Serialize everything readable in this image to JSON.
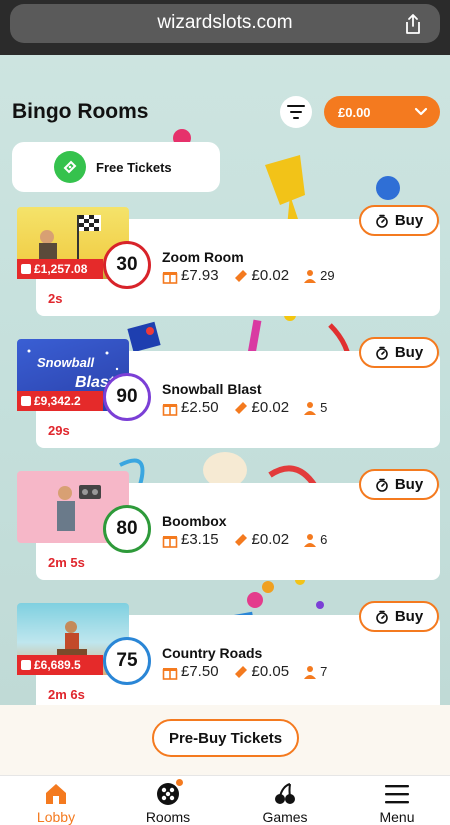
{
  "browser": {
    "url": "wizardslots.com"
  },
  "header": {
    "title": "Bingo Rooms",
    "balance": "£0.00"
  },
  "free_tickets": {
    "label": "Free Tickets"
  },
  "rooms": [
    {
      "name": "Zoom Room",
      "ball": "30",
      "ball_color": "#d8232a",
      "jackpot": "£1,257.08",
      "prize": "£7.93",
      "ticket_price": "£0.02",
      "players": "29",
      "timer": "2s",
      "buy_label": "Buy"
    },
    {
      "name": "Snowball Blast",
      "ball": "90",
      "ball_color": "#7b3fd6",
      "jackpot": "£9,342.2",
      "prize": "£2.50",
      "ticket_price": "£0.02",
      "players": "5",
      "timer": "29s",
      "buy_label": "Buy",
      "thumb_text_1": "Snowball",
      "thumb_text_2": "Blast"
    },
    {
      "name": "Boombox",
      "ball": "80",
      "ball_color": "#2e9a3a",
      "jackpot": "",
      "prize": "£3.15",
      "ticket_price": "£0.02",
      "players": "6",
      "timer": "2m 5s",
      "buy_label": "Buy"
    },
    {
      "name": "Country Roads",
      "ball": "75",
      "ball_color": "#2a86d6",
      "jackpot": "£6,689.5",
      "prize": "£7.50",
      "ticket_price": "£0.05",
      "players": "7",
      "timer": "2m 6s",
      "buy_label": "Buy"
    }
  ],
  "prebuy": {
    "label": "Pre-Buy Tickets"
  },
  "nav": [
    {
      "label": "Lobby",
      "icon": "home-icon",
      "active": true
    },
    {
      "label": "Rooms",
      "icon": "bingo-ball-icon"
    },
    {
      "label": "Games",
      "icon": "cherries-icon"
    },
    {
      "label": "Menu",
      "icon": "hamburger-icon"
    }
  ],
  "colors": {
    "accent": "#f47a1f",
    "timer": "#e0262d",
    "jackpot": "#e52a2a",
    "free_ticket": "#35c24d"
  }
}
